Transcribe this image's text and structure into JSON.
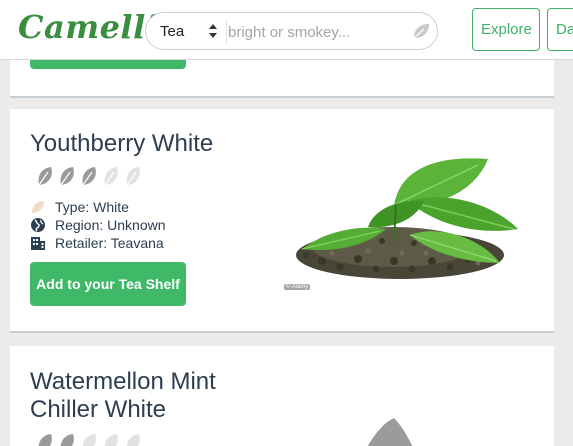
{
  "header": {
    "logo": "Camellia",
    "search": {
      "category": "Tea",
      "placeholder": "bright or smokey..."
    },
    "nav": {
      "explore": "Explore",
      "second_partial": "Da"
    }
  },
  "teas": [
    {
      "name": "Youthberry White",
      "rating": 3,
      "rating_max": 5,
      "type_label": "Type: White",
      "region_label": "Region: Unknown",
      "retailer_label": "Retailer: Teavana",
      "add_button": "Add to your Tea Shelf",
      "photo_credit": "© Alamy"
    },
    {
      "name": "Watermellon Mint Chiller White",
      "rating": 2,
      "rating_max": 5
    }
  ],
  "colors": {
    "brand_green": "#3a8e3f",
    "button_green": "#3fb868",
    "outline_green": "#3eb06a",
    "leaf_filled": "#9a9a9a",
    "leaf_empty": "#e2e2e2"
  },
  "icons": {
    "type": "tea-leaf-icon",
    "region": "globe-icon",
    "retailer": "building-icon",
    "search": "leaf-icon"
  }
}
